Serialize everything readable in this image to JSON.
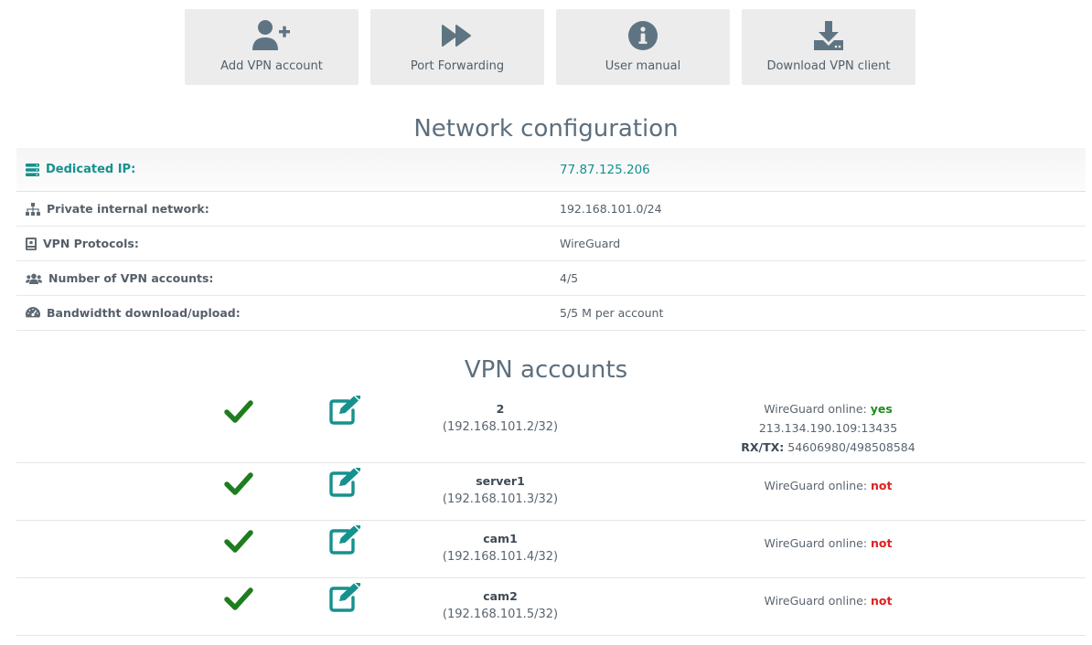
{
  "toolbar": {
    "items": [
      {
        "label": "Add VPN account",
        "icon": "add-user-icon"
      },
      {
        "label": "Port Forwarding",
        "icon": "fast-forward-icon"
      },
      {
        "label": "User manual",
        "icon": "info-icon"
      },
      {
        "label": "Download VPN client",
        "icon": "download-icon"
      }
    ]
  },
  "network": {
    "title": "Network configuration",
    "rows": [
      {
        "label": "Dedicated IP:",
        "value": "77.87.125.206",
        "icon": "server-icon"
      },
      {
        "label": "Private internal network:",
        "value": "192.168.101.0/24",
        "icon": "sitemap-icon"
      },
      {
        "label": "VPN Protocols:",
        "value": "WireGuard",
        "icon": "book-icon"
      },
      {
        "label": "Number of VPN accounts:",
        "value": "4/5",
        "icon": "users-icon"
      },
      {
        "label": "Bandwidtht download/upload:",
        "value": "5/5 M per account",
        "icon": "gauge-icon"
      }
    ]
  },
  "accounts": {
    "title": "VPN accounts",
    "status_label": "WireGuard online:",
    "rxtx_label": "RX/TX:",
    "rows": [
      {
        "name": "2",
        "ip": "(192.168.101.2/32)",
        "online": "yes",
        "endpoint": "213.134.190.109:13435",
        "rxtx": " 54606980/498508584"
      },
      {
        "name": "server1",
        "ip": "(192.168.101.3/32)",
        "online": "not"
      },
      {
        "name": "cam1",
        "ip": "(192.168.101.4/32)",
        "online": "not"
      },
      {
        "name": "cam2",
        "ip": "(192.168.101.5/32)",
        "online": "not"
      }
    ]
  },
  "colors": {
    "accent": "#15918e",
    "icon_gray": "#5f7482",
    "check_green": "#1e7d1e",
    "online_yes": "#1e8c1e",
    "online_no": "#e02020"
  }
}
